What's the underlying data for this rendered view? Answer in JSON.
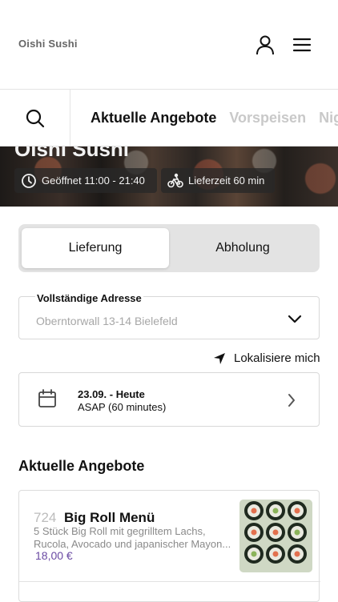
{
  "header": {
    "brand": "Oishi Sushi",
    "icons": [
      "user-icon",
      "menu-icon"
    ]
  },
  "categories": {
    "tabs": [
      {
        "label": "Aktuelle Angebote",
        "active": true
      },
      {
        "label": "Vorspeisen",
        "active": false
      },
      {
        "label": "Nigiri",
        "active": false
      }
    ]
  },
  "hero": {
    "title": "Oishi Sushi",
    "open_hours": "Geöffnet 11:00 - 21:40",
    "delivery_time": "Lieferzeit 60 min"
  },
  "order_type": {
    "delivery": "Lieferung",
    "pickup": "Abholung",
    "selected": "Lieferung"
  },
  "address": {
    "label": "Vollständige Adresse",
    "value": "Oberntorwall 13-14 Bielefeld",
    "locate_label": "Lokalisiere mich"
  },
  "schedule": {
    "date": "23.09. - Heute",
    "time": "ASAP (60 minutes)"
  },
  "offers": {
    "title": "Aktuelle Angebote",
    "items": [
      {
        "number": "724",
        "name": "Big Roll Menü",
        "description_line1": "5 Stück Big Roll mit gegrilltem Lachs,",
        "description_line2": "Rucola, Avocado und japanischer Mayon...",
        "price": "18,00 €"
      }
    ]
  },
  "colors": {
    "accent": "#6a4aa3",
    "text": "#111111",
    "muted": "#a7a7a7"
  }
}
